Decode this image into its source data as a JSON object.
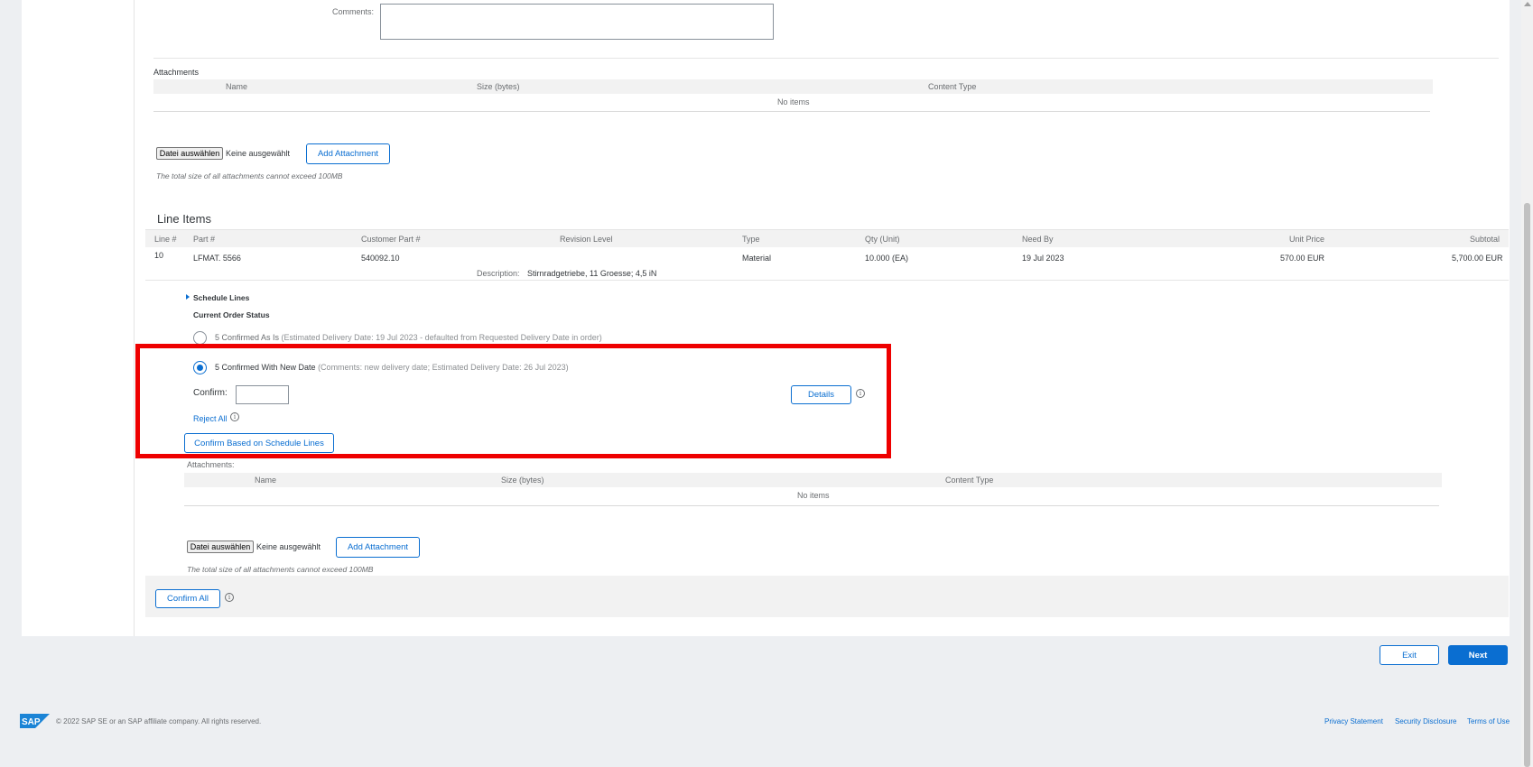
{
  "comments_label": "Comments:",
  "attachments_top": {
    "title": "Attachments",
    "columns": [
      "Name",
      "Size (bytes)",
      "Content Type"
    ],
    "empty": "No items",
    "file_button": "Datei auswählen",
    "file_status": "Keine ausgewählt",
    "add_button": "Add Attachment",
    "hint": "The total size of all attachments cannot exceed 100MB"
  },
  "line_items": {
    "title": "Line Items",
    "columns": [
      "Line #",
      "Part #",
      "Customer Part #",
      "Revision Level",
      "Type",
      "Qty (Unit)",
      "Need By",
      "Unit Price",
      "Subtotal"
    ],
    "row": {
      "line": "10",
      "part": "LFMAT. 5566",
      "customer_part": "540092.10",
      "type": "Material",
      "qty": "10.000 (EA)",
      "need_by": "19 Jul 2023",
      "unit_price": "570.00 EUR",
      "subtotal": "5,700.00 EUR",
      "description_label": "Description:",
      "description": "Stirnradgetriebe, 11 Groesse; 4,5 iN"
    },
    "schedule_lines": "Schedule Lines",
    "current_status": "Current Order Status",
    "option1_label": "5 Confirmed As Is",
    "option1_detail": "(Estimated Delivery Date: 19 Jul 2023 - defaulted from Requested Delivery Date in order)",
    "option2_label": "5 Confirmed With New Date",
    "option2_detail": "(Comments: new delivery date; Estimated Delivery Date: 26 Jul 2023)",
    "confirm_label": "Confirm:",
    "confirm_value": "",
    "details_button": "Details",
    "reject_all": "Reject All",
    "confirm_schedule_button": "Confirm Based on Schedule Lines"
  },
  "attachments_line": {
    "title": "Attachments:",
    "columns": [
      "Name",
      "Size (bytes)",
      "Content Type"
    ],
    "empty": "No items",
    "file_button": "Datei auswählen",
    "file_status": "Keine ausgewählt",
    "add_button": "Add Attachment",
    "hint": "The total size of all attachments cannot exceed 100MB"
  },
  "confirm_all_button": "Confirm All",
  "nav": {
    "exit": "Exit",
    "next": "Next"
  },
  "footer": {
    "logo_text": "SAP",
    "copyright": "© 2022 SAP SE or an SAP affiliate company. All rights reserved.",
    "links": [
      "Privacy Statement",
      "Security Disclosure",
      "Terms of Use"
    ]
  },
  "colors": {
    "accent": "#0a6ed1",
    "highlight": "#ee0000"
  }
}
